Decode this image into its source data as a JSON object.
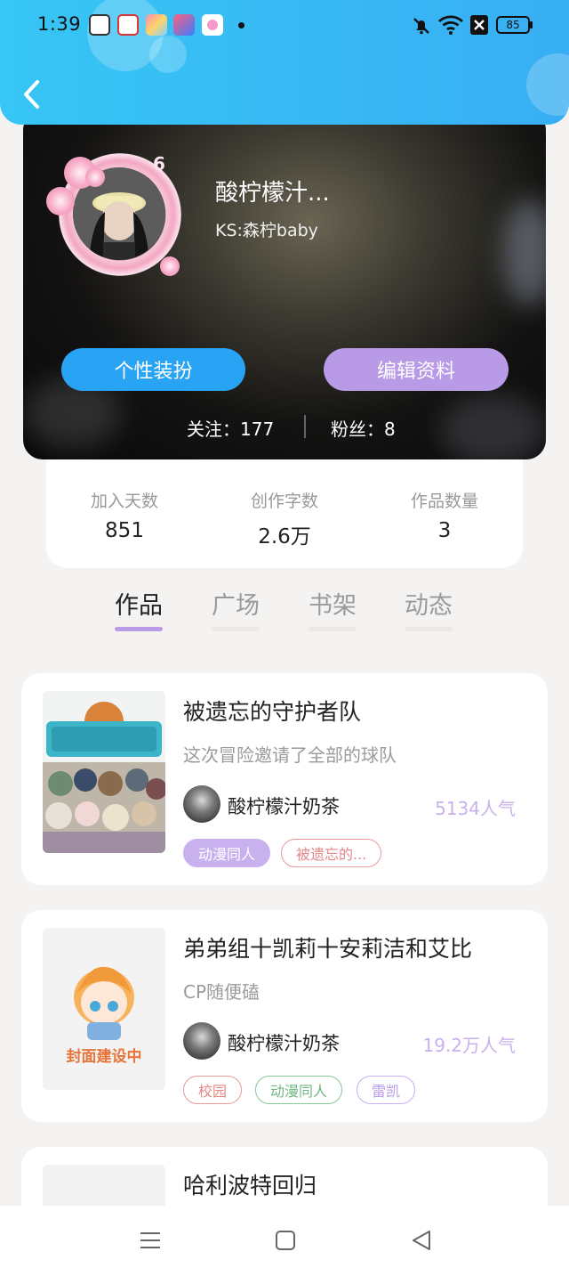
{
  "status_bar": {
    "time": "1:39",
    "battery": "85",
    "icons": [
      "game-app-icon",
      "video-app-icon",
      "anime-app-icon",
      "shortcut-app-icon",
      "pink-app-icon"
    ]
  },
  "profile": {
    "level": "6",
    "nickname": "酸柠檬汁...",
    "ks_id": "KS:森柠baby",
    "dress_button": "个性装扮",
    "edit_button": "编辑资料",
    "following_label": "关注：",
    "following_count": "177",
    "fans_label": "粉丝：",
    "fans_count": "8"
  },
  "stats": [
    {
      "label": "加入天数",
      "value": "851"
    },
    {
      "label": "创作字数",
      "value": "2.6万"
    },
    {
      "label": "作品数量",
      "value": "3"
    }
  ],
  "tabs": [
    "作品",
    "广场",
    "书架",
    "动态"
  ],
  "active_tab": "作品",
  "works": [
    {
      "title": "被遗忘的守护者队",
      "desc": "这次冒险邀请了全部的球队",
      "author": "酸柠檬汁奶茶",
      "popularity": "5134人气",
      "cover_text": "",
      "tags": [
        "动漫同人",
        "被遗忘的..."
      ]
    },
    {
      "title": "弟弟组十凯莉十安莉洁和艾比",
      "desc": "CP随便磕",
      "author": "酸柠檬汁奶茶",
      "popularity": "19.2万人气",
      "cover_text": "封面建设中",
      "tags": [
        "校园",
        "动漫同人",
        "雷凯"
      ]
    },
    {
      "title": "哈利波特回归"
    }
  ],
  "colors": {
    "header": "#38aef3",
    "dress_button": "#29a4f4",
    "edit_button": "#b89ae6",
    "accent": "#b99be7",
    "popularity": "#c8b1ec"
  }
}
